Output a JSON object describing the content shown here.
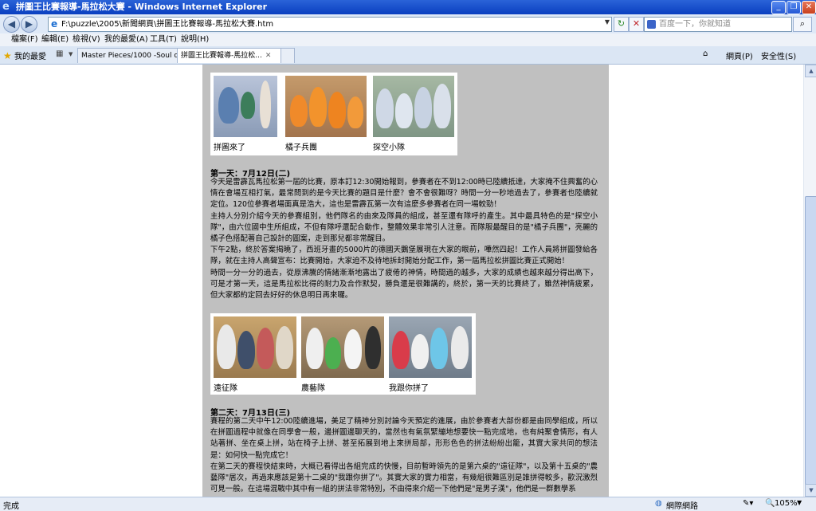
{
  "window": {
    "title": "拼圖王比賽報導-馬拉松大賽 - Windows Internet Explorer",
    "buttons": [
      "_",
      "❐",
      "✕"
    ]
  },
  "address": {
    "url": "F:\\puzzle\\2005\\新聞網頁\\拼圖王比賽報導-馬拉松大賽.htm",
    "search_placeholder": "百度一下，你就知道"
  },
  "menu": [
    "檔案(F)",
    "編輯(E)",
    "檢視(V)",
    "我的最愛(A)",
    "工具(T)",
    "說明(H)"
  ],
  "favorites_label": "我的最愛",
  "tabs": [
    {
      "label": "Master Pieces/1000 -Soul of t...",
      "active": false
    },
    {
      "label": "拼圖王比賽報導-馬拉松...",
      "active": true
    }
  ],
  "tools": {
    "page": "網頁(P)",
    "safety": "安全性(S)"
  },
  "content": {
    "row1": [
      "拼圖來了",
      "橘子兵團",
      "探空小隊"
    ],
    "day1": {
      "title": "第一天：7月12日(二)",
      "paras": [
        "今天是雷霹瓦馬拉松第一屆的比賽，原本訂12:30開始報到，參賽者在不到12:00時已陸續抵達，大家掩不住興奮的心情在會場互相打氣，最常問到的是今天比賽的題目是什麼？會不會很難呀？時間一分一秒地過去了，參賽者也陸續就定位。120位參賽者場面真是浩大，這也是雷霹瓦第一次有這麼多參賽者在同一場較勁！",
        "主持人分別介紹今天的參賽組別，他們隊名的由來及隊員的組成，甚至還有隊呼的產生。其中最具特色的是\"探空小隊\"，由六位國中生所組成，不但有隊呼還配合動作，整體效果非常引人注意。而隊服最醒目的是\"橘子兵團\"，亮麗的橘子色搭配著自己設計的圖案，走到那兒都非常醒目。",
        "下午2點，終於答案揭曉了，西班牙畫的5000片的德國天鵝堡展現在大家的眼前，嘩然四起！工作人員將拼圖發給各隊，就在主持人高聲宣布：比賽開始，大家迫不及待地拆封開始分配工作，第一屆馬拉松拼圖比賽正式開始！",
        "時間一分一分的過去，從原沸騰的情緒漸漸地露出了疲倦的神情，時間過的越多，大家的成績也越來越分得出高下，可是才第一天，這是馬拉松比得的耐力及合作默契，勝負還是很難講的，終於，第一天的比賽終了，雖然神情疲累，但大家都約定回去好好的休息明日再來囉。"
      ]
    },
    "row2": [
      "遠征隊",
      "農藝隊",
      "我跟你拼了"
    ],
    "day2": {
      "title": "第二天：7月13日(三)",
      "paras": [
        "賽程的第二天中午12:00陸續進場，美足了精神分別討論今天預定的進展，由於參賽者大部份都是由同學組成，所以在拼圖過程中就像在同學會一般，邊拼圖邊聊天的，當然也有氣氛緊繃地想要快一點完成地，也有純聚會情形，有人站著拼、坐在桌上拼，站在椅子上拼、甚至拓展到地上來拼局部，形形色色的拼法紛紛出籠，其實大家共同的想法是：如何快一點完成它！",
        "在第二天的賽程快結束時，大概已看得出各組完成的快慢，目前暫時領先的是第六桌的\"遠征隊\"，以及第十五桌的\"農藝隊\"居次，再過來應該是第十二桌的\"我跟你拼了\"。其實大家的實力相當，有幾組很難區別是誰拼得較多，歡況激烈可見一般。在這場混戰中其中有一組的拼法非常特別，不由得來介紹一下他們是\"是男子漢\"，他們是一群數學系"
      ]
    }
  },
  "status": {
    "left": "完成",
    "zone": "網際網路",
    "zoom": "105%"
  }
}
